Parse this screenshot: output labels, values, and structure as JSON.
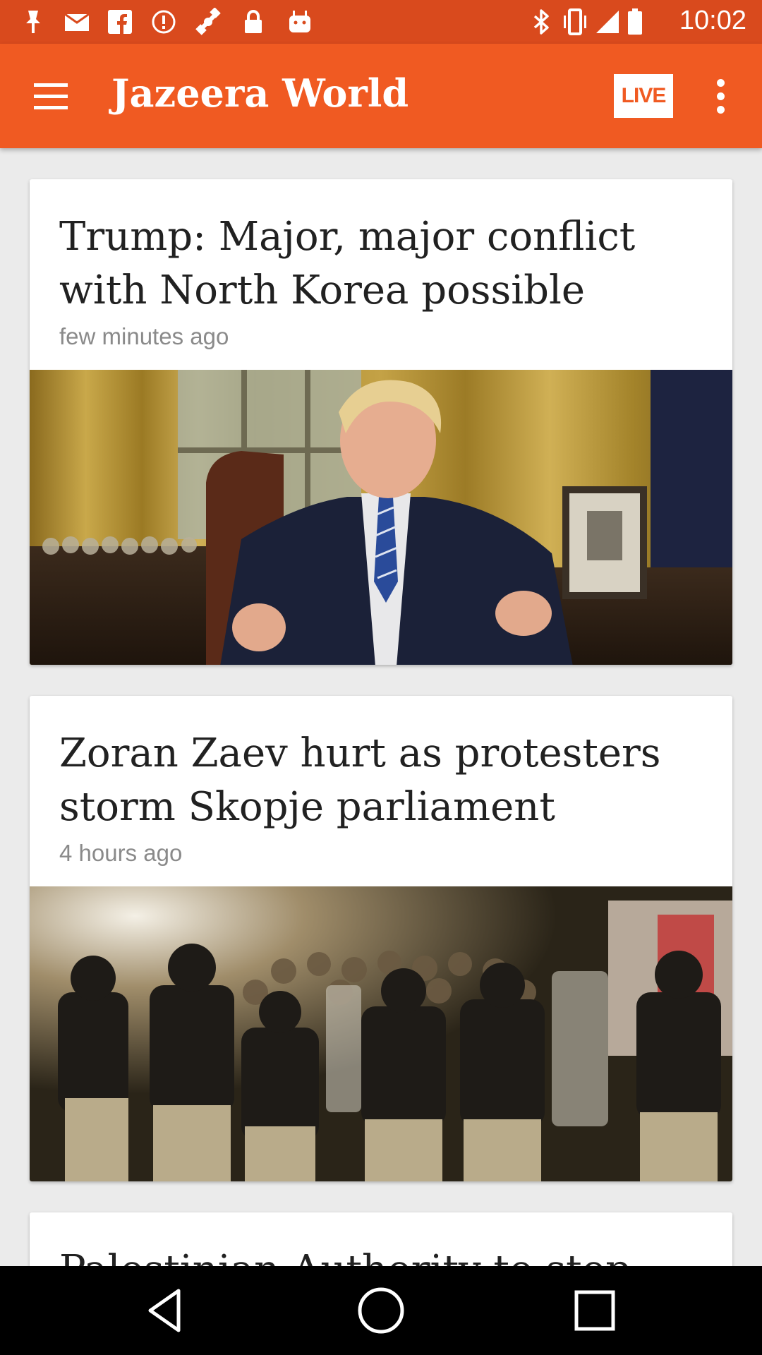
{
  "status_bar": {
    "time": "10:02",
    "icons": [
      "notification-icon",
      "mail-icon",
      "facebook-icon",
      "info-icon",
      "fake-gps-icon",
      "lock-icon",
      "android-icon",
      "bluetooth-icon",
      "vibrate-icon",
      "signal-icon",
      "battery-icon"
    ]
  },
  "app_bar": {
    "title": "Jazeera World",
    "live_label": "LIVE",
    "color": "#f05a22",
    "status_color": "#d94a1d"
  },
  "articles": [
    {
      "title": "Trump: Major, major conflict with North Korea possible",
      "time": "few minutes ago"
    },
    {
      "title": "Zoran Zaev hurt as protesters storm Skopje parliament",
      "time": "4 hours ago"
    },
    {
      "title": "Palestinian Authority to stop"
    }
  ],
  "nav_bar": {
    "icons": [
      "back-icon",
      "home-icon",
      "recents-icon"
    ]
  }
}
